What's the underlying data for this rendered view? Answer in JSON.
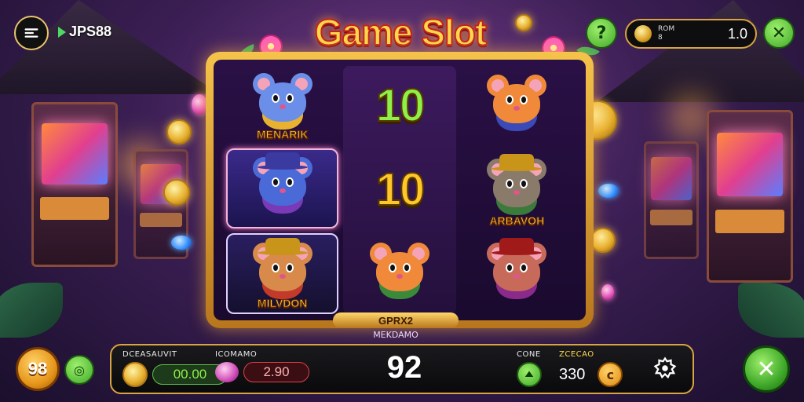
{
  "header": {
    "brand": "JPS88",
    "title": "Game Slot",
    "info_label_1": "ROM",
    "info_label_2": "8",
    "info_value": "1.0"
  },
  "reels": [
    [
      {
        "type": "character",
        "label": "MENARIK",
        "fur": "#6b8ee8",
        "accent": "#e8b230",
        "hat": null
      },
      {
        "type": "character",
        "label": "",
        "fur": "#4a6ad8",
        "accent": "#7a3ab8",
        "hat": "#3a3aa0",
        "highlight": true
      },
      {
        "type": "character",
        "label": "MILVDON",
        "fur": "#d88a4a",
        "accent": "#c23a2a",
        "hat": "#c8941a",
        "highlight2": true
      }
    ],
    [
      {
        "type": "number",
        "value": "10",
        "color": "green"
      },
      {
        "type": "number",
        "value": "10",
        "color": "gold"
      },
      {
        "type": "character",
        "label": "",
        "fur": "#f08a3a",
        "accent": "#3a8a3a",
        "hat": null
      }
    ],
    [
      {
        "type": "character",
        "label": "",
        "fur": "#f08a3a",
        "accent": "#3a4ab8",
        "hat": null
      },
      {
        "type": "character",
        "label": "ARBAVOH",
        "fur": "#8a7a6a",
        "accent": "#3a7a3a",
        "hat": "#c8941a"
      },
      {
        "type": "character",
        "label": "",
        "fur": "#c86a5a",
        "accent": "#8a2a8a",
        "hat": "#a01a1a"
      }
    ]
  ],
  "frame_banner": "GPRX2",
  "frame_sub": "MEKDAMO",
  "bottom": {
    "left_label": "DCEASAUVIT",
    "left_value": "00.00",
    "mid_label": "ICOMAMO",
    "mid_value": "2.90",
    "big_number": "92",
    "right_label_1": "CONE",
    "right_label_2": "ZCECAO",
    "right_value": "330"
  },
  "corners": {
    "left_button": "98"
  },
  "colors": {
    "accent_gold": "#d9a441",
    "green_button": "#3fa82a",
    "title_yellow": "#ffd84a"
  },
  "icons": [
    "menu-icon",
    "play-icon",
    "help-icon",
    "coin-icon",
    "close-icon",
    "gear-icon",
    "arrow-icon"
  ]
}
